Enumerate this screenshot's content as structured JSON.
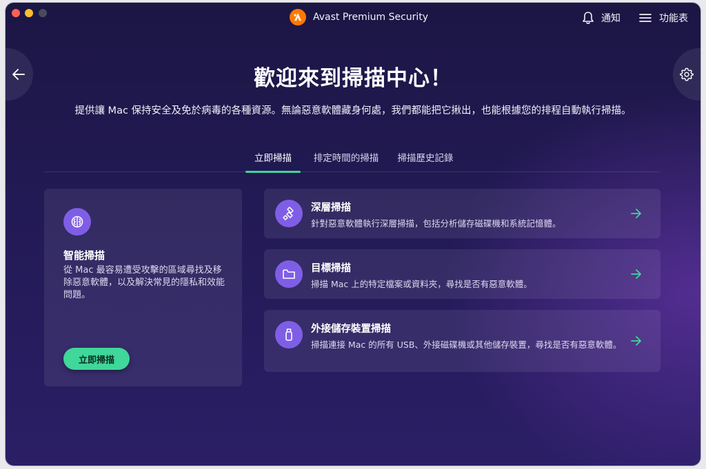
{
  "window": {
    "app_title": "Avast Premium Security",
    "notifications_label": "通知",
    "menu_label": "功能表"
  },
  "main": {
    "headline": "歡迎來到掃描中心！",
    "subline": "提供讓 Mac 保持安全及免於病毒的各種資源。無論惡意軟體藏身何處，我們都能把它揪出，也能根據您的排程自動執行掃描。"
  },
  "tabs": [
    {
      "label": "立即掃描",
      "active": true
    },
    {
      "label": "排定時間的掃描",
      "active": false
    },
    {
      "label": "掃描歷史記錄",
      "active": false
    }
  ],
  "smart_scan": {
    "icon": "brain-icon",
    "title": "智能掃描",
    "description": "從 Mac 最容易遭受攻擊的區域尋找及移除惡意軟體，以及解決常見的隱私和效能問題。",
    "button_label": "立即掃描"
  },
  "scan_cards": [
    {
      "icon": "deep-scan-icon",
      "title": "深層掃描",
      "description": "針對惡意軟體執行深層掃描，包括分析儲存磁碟機和系統記憶體。"
    },
    {
      "icon": "folder-icon",
      "title": "目標掃描",
      "description": "掃描 Mac 上的特定檔案或資料夾，尋找是否有惡意軟體。"
    },
    {
      "icon": "usb-icon",
      "title": "外接儲存裝置掃描",
      "description": "掃描連接 Mac 的所有 USB、外接磁碟機或其他儲存裝置，尋找是否有惡意軟體。"
    }
  ],
  "colors": {
    "accent": "#3fd79a",
    "icon_circle": "#7f5ee6",
    "brand_orange": "#ff7800",
    "background": "#221a55"
  }
}
